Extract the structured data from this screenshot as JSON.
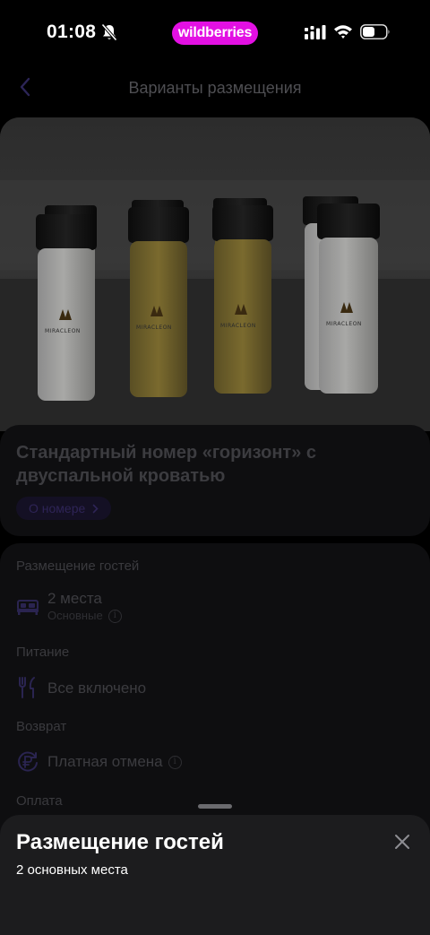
{
  "status_bar": {
    "time": "01:08",
    "brand": "wildberries",
    "brand_color": "#e310e3"
  },
  "nav": {
    "back_icon": "chevron-left-icon",
    "title": "Варианты размещения"
  },
  "room": {
    "title": "Стандартный номер «горизонт» с двуспальной кроватью",
    "about_button": "О номере",
    "photo_brand": "MIRACLEON",
    "carousel": {
      "count": 5,
      "active": 1
    }
  },
  "details": {
    "guests": {
      "label": "Размещение гостей",
      "icon": "bed-icon",
      "value": "2 места",
      "sub": "Основные"
    },
    "food": {
      "label": "Питание",
      "icon": "fork-knife-icon",
      "value": "Все включено"
    },
    "refund": {
      "label": "Возврат",
      "icon": "ruble-refund-icon",
      "value": "Платная отмена"
    },
    "payment": {
      "label": "Оплата"
    }
  },
  "sheet": {
    "title": "Размещение гостей",
    "subtitle": "2 основных места",
    "close_icon": "close-icon"
  }
}
